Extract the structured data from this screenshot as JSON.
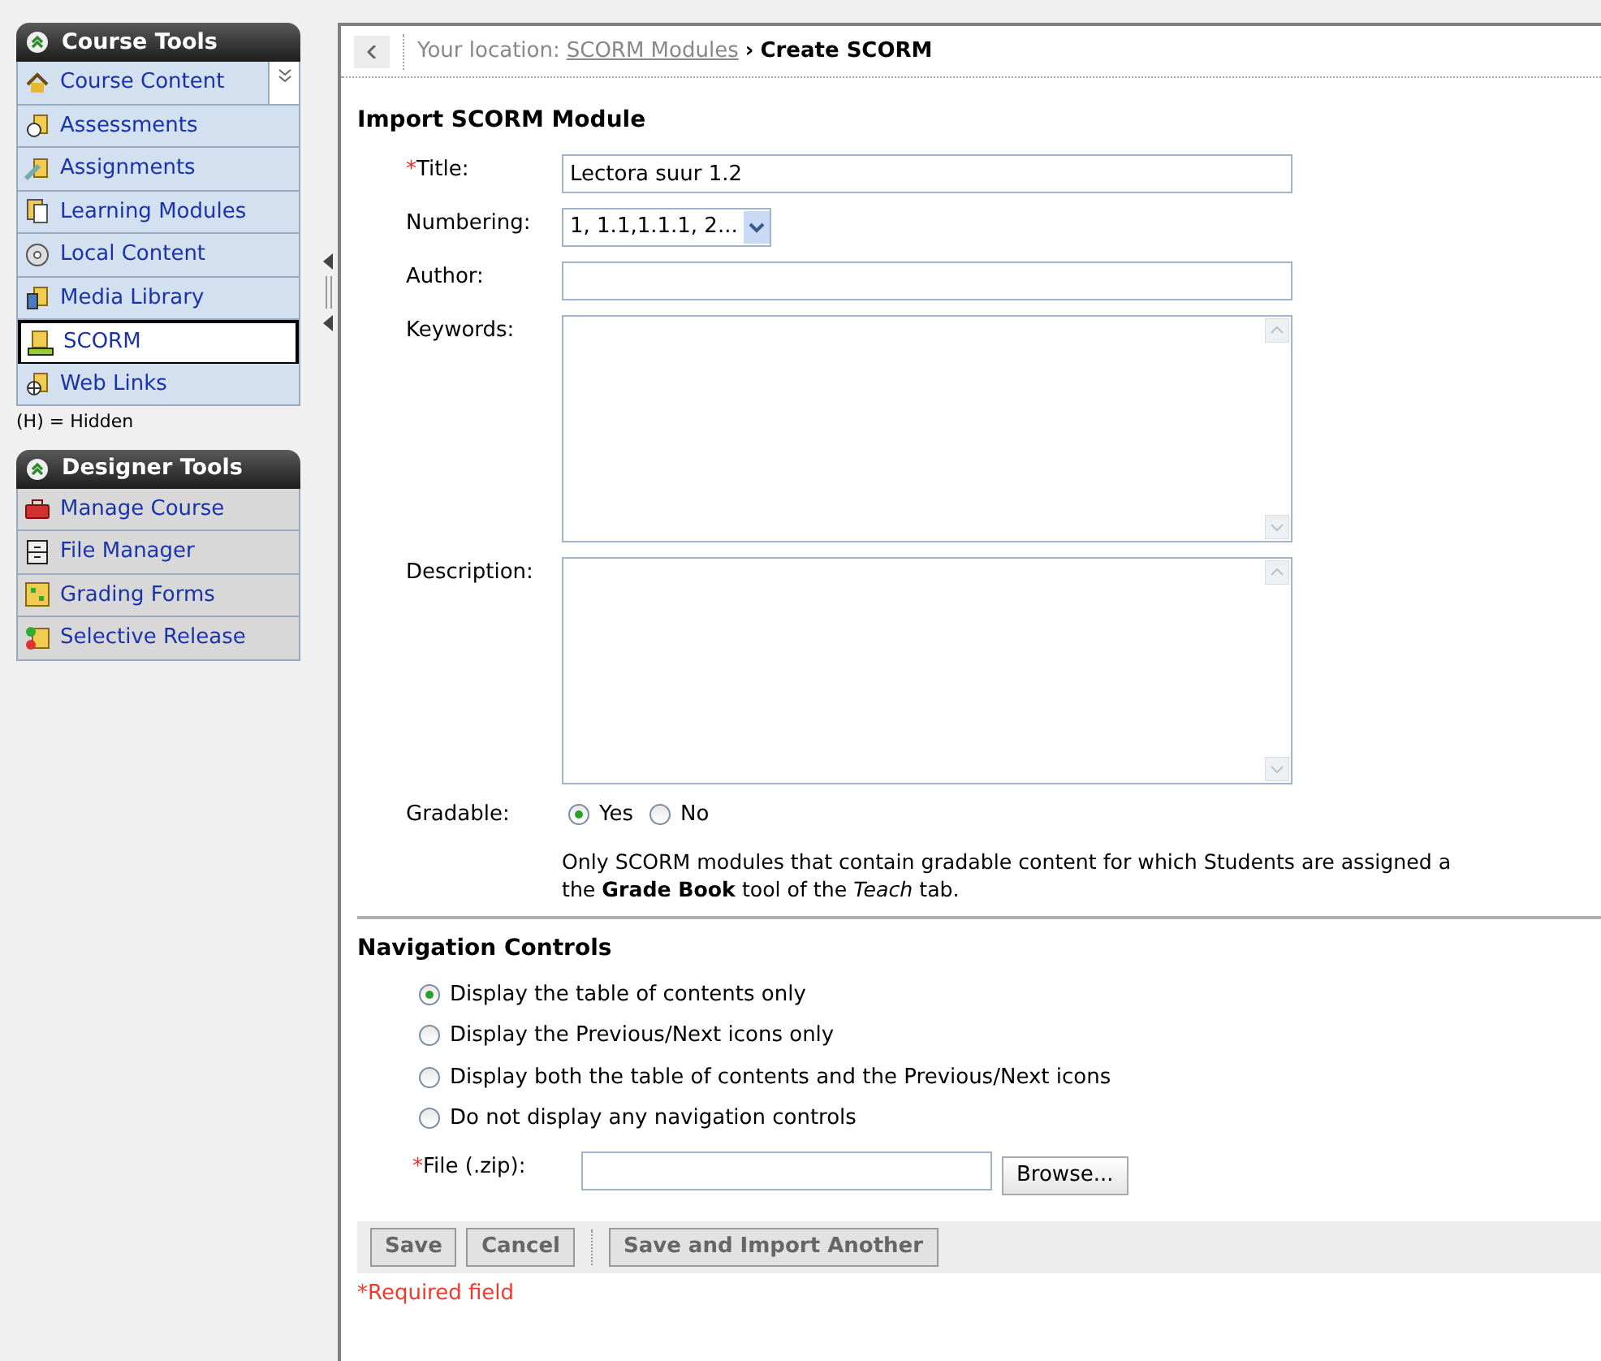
{
  "sidebar": {
    "course_tools": {
      "title": "Course Tools",
      "items": [
        {
          "label": "Course Content",
          "selected": false
        },
        {
          "label": "Assessments",
          "selected": false
        },
        {
          "label": "Assignments",
          "selected": false
        },
        {
          "label": "Learning Modules",
          "selected": false
        },
        {
          "label": "Local Content",
          "selected": false
        },
        {
          "label": "Media Library",
          "selected": false
        },
        {
          "label": "SCORM",
          "selected": true
        },
        {
          "label": "Web Links",
          "selected": false
        }
      ],
      "hidden_note": "(H) = Hidden"
    },
    "designer_tools": {
      "title": "Designer Tools",
      "items": [
        {
          "label": "Manage Course",
          "selected": false
        },
        {
          "label": "File Manager",
          "selected": false
        },
        {
          "label": "Grading Forms",
          "selected": false
        },
        {
          "label": "Selective Release",
          "selected": false
        }
      ]
    }
  },
  "breadcrumb": {
    "prefix": "Your location:",
    "link": "SCORM Modules",
    "separator": "›",
    "current": "Create SCORM"
  },
  "form": {
    "heading": "Import SCORM Module",
    "title": {
      "required_mark": "*",
      "label": "Title:",
      "value": "Lectora suur 1.2"
    },
    "numbering": {
      "label": "Numbering:",
      "value": "1, 1.1,1.1.1, 2..."
    },
    "author": {
      "label": "Author:"
    },
    "keywords": {
      "label": "Keywords:"
    },
    "description": {
      "label": "Description:"
    },
    "gradable": {
      "label": "Gradable:",
      "options": [
        {
          "label": "Yes",
          "selected": true
        },
        {
          "label": "No",
          "selected": false
        }
      ],
      "note": "Only SCORM modules that contain gradable content for which Students are assigned a",
      "note_2": "the **Grade Book** tool of the *Teach* tab."
    }
  },
  "navigation": {
    "heading": "Navigation Controls",
    "options": [
      {
        "label": "Display the table of contents only",
        "selected": true
      },
      {
        "label": "Display the Previous/Next icons only",
        "selected": false
      },
      {
        "label": "Display both the table of contents and the Previous/Next icons",
        "selected": false
      },
      {
        "label": "Do not display any navigation controls",
        "selected": false
      }
    ],
    "file": {
      "required_mark": "*",
      "label": "File (.zip):",
      "button": "Browse..."
    }
  },
  "buttons": [
    "Save",
    "Cancel",
    "Save and Import Another"
  ],
  "required_note": "*Required field"
}
